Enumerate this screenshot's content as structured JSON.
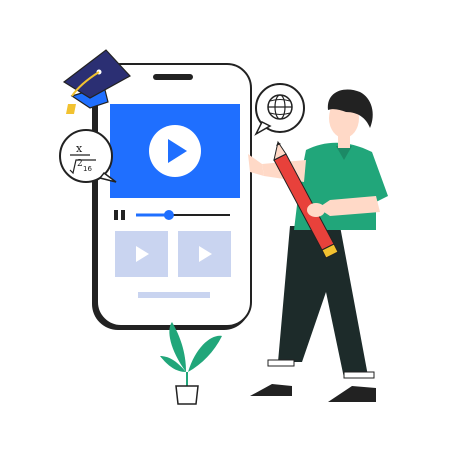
{
  "illustration": {
    "icons": [
      "graduation-cap-icon",
      "math-formula-bubble-icon",
      "globe-bubble-icon",
      "play-icon",
      "pause-icon",
      "pencil-icon",
      "plant-icon"
    ],
    "math_bubble": {
      "numerator": "x",
      "denominator": "2",
      "root_value": "16"
    }
  },
  "player": {
    "progress": 0.35
  },
  "colors": {
    "primary_blue": "#1f6fff",
    "light_tile": "#c9d4f0",
    "shirt_green": "#21a67a",
    "pencil_red": "#e8413b",
    "pants_dark": "#1d2b2a",
    "cap_navy": "#2b2f73",
    "outline": "#222222"
  }
}
